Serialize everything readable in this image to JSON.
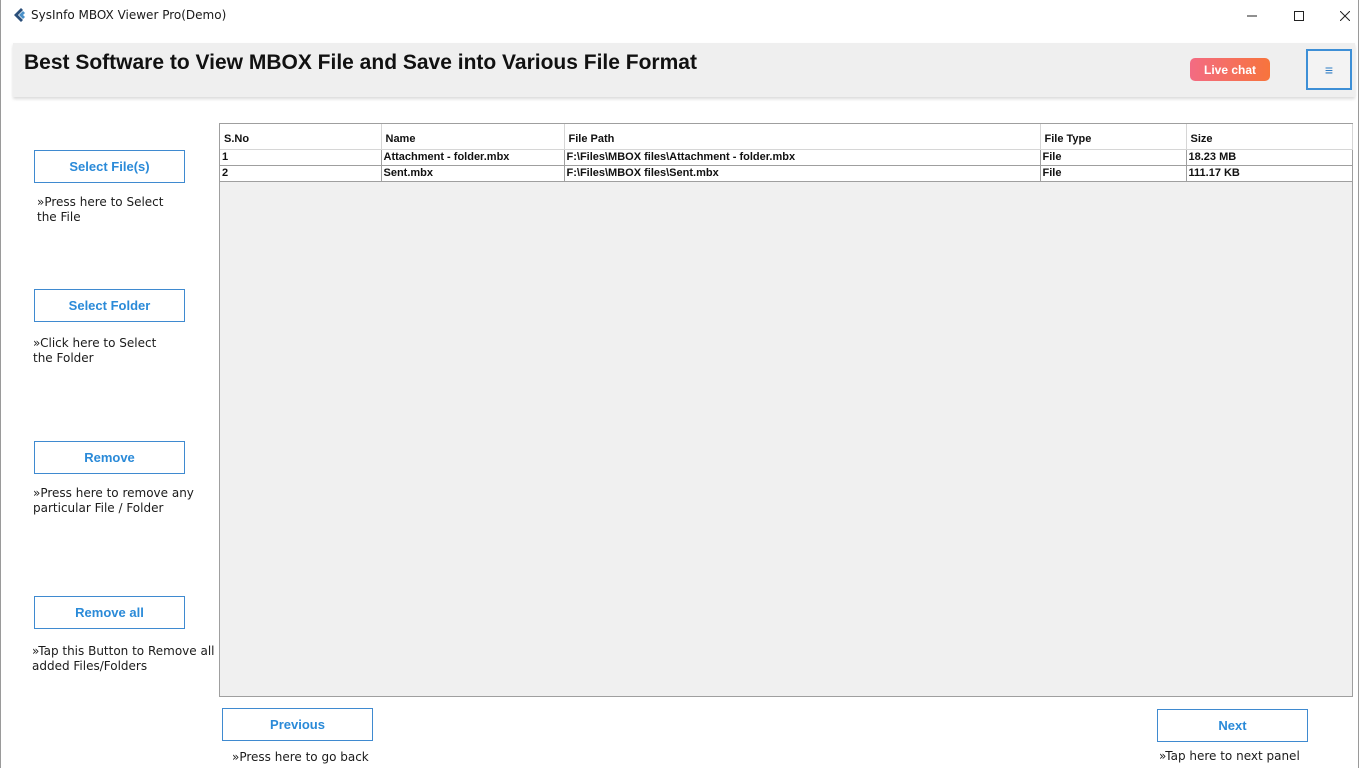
{
  "window": {
    "title": "SysInfo MBOX Viewer Pro(Demo)",
    "controls": {
      "minimize_icon": "minimize-icon",
      "maximize_icon": "maximize-icon",
      "close_icon": "close-icon"
    }
  },
  "banner": {
    "title": "Best Software to View MBOX File and Save into Various File Format",
    "live_chat_label": "Live chat",
    "menu_icon": "hamburger-menu-icon",
    "menu_glyph": "≡"
  },
  "sidebar": {
    "select_files": {
      "label": "Select File(s)",
      "hint_line1": "»Press here to Select",
      "hint_line2": "the File"
    },
    "select_folder": {
      "label": "Select Folder",
      "hint_line1": "»Click here to Select",
      "hint_line2": "the Folder"
    },
    "remove": {
      "label": "Remove",
      "hint_line1": "»Press here to remove any",
      "hint_line2": "particular File / Folder"
    },
    "remove_all": {
      "label": "Remove all",
      "hint_line1": "»Tap this Button to Remove all",
      "hint_line2": "added Files/Folders"
    }
  },
  "table": {
    "columns": [
      "S.No",
      "Name",
      "File Path",
      "File Type",
      "Size"
    ],
    "rows": [
      [
        "1",
        "Attachment - folder.mbx",
        "F:\\Files\\MBOX files\\Attachment - folder.mbx",
        "File",
        "18.23 MB"
      ],
      [
        "2",
        "Sent.mbx",
        "F:\\Files\\MBOX files\\Sent.mbx",
        "File",
        "111.17 KB"
      ]
    ]
  },
  "footer": {
    "previous_label": "Previous",
    "previous_hint": "»Press here to go back",
    "next_label": "Next",
    "next_hint": "»Tap here to next panel"
  },
  "colors": {
    "accent": "#2a8ad8",
    "button_border": "#3f8ad0",
    "live_chat_start": "#f36b83",
    "live_chat_end": "#f7743c",
    "banner_bg": "#efefef"
  }
}
